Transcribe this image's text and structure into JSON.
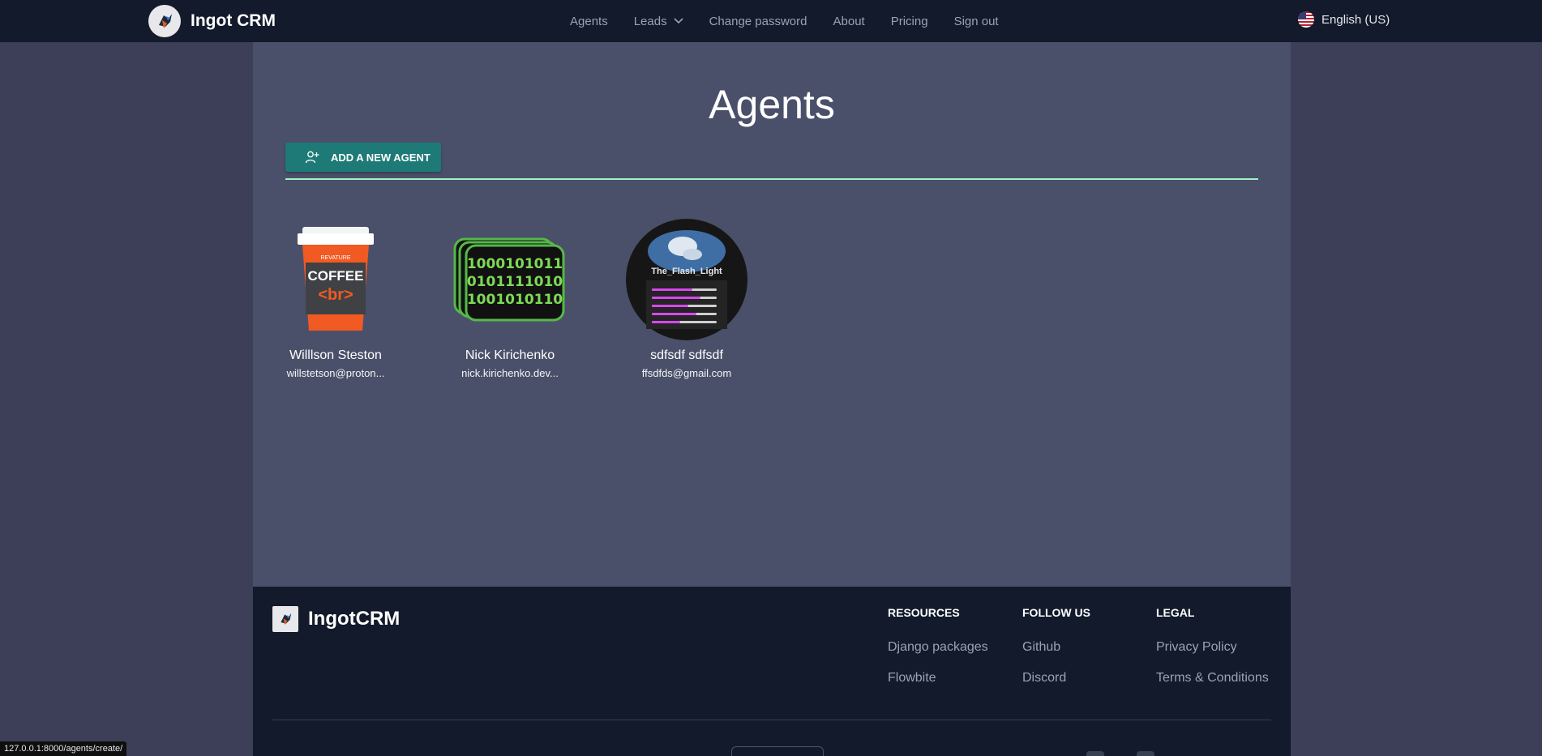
{
  "navbar": {
    "brand": "Ingot CRM",
    "links": [
      {
        "label": "Agents"
      },
      {
        "label": "Leads"
      },
      {
        "label": "Change password"
      },
      {
        "label": "About"
      },
      {
        "label": "Pricing"
      },
      {
        "label": "Sign out"
      }
    ],
    "language": "English (US)"
  },
  "main": {
    "title": "Agents",
    "add_button": "ADD A NEW AGENT",
    "agents": [
      {
        "name": "Willlson Steston",
        "email": "willstetson@proton..."
      },
      {
        "name": "Nick Kirichenko",
        "email": "nick.kirichenko.dev..."
      },
      {
        "name": "sdfsdf sdfsdf",
        "email": "ffsdfds@gmail.com"
      }
    ],
    "avatar_text": {
      "coffee_brand": "REVATURE",
      "coffee_word": "COFFEE",
      "coffee_tag": "<br>",
      "binary": [
        "1000101011",
        "0101111010",
        "1001010110"
      ],
      "flash": "The_Flash_Light"
    }
  },
  "footer": {
    "brand": "IngotCRM",
    "columns": [
      {
        "title": "RESOURCES",
        "links": [
          "Django packages",
          "Flowbite"
        ]
      },
      {
        "title": "FOLLOW US",
        "links": [
          "Github",
          "Discord"
        ]
      },
      {
        "title": "LEGAL",
        "links": [
          "Privacy Policy",
          "Terms & Conditions"
        ]
      }
    ]
  },
  "status_url": "127.0.0.1:8000/agents/create/",
  "colors": {
    "page_bg": "#3d3f58",
    "panel_bg": "#4a5069",
    "nav_bg": "#121a2b",
    "accent_button": "#1e7a77",
    "divider": "#9ff0c5"
  }
}
